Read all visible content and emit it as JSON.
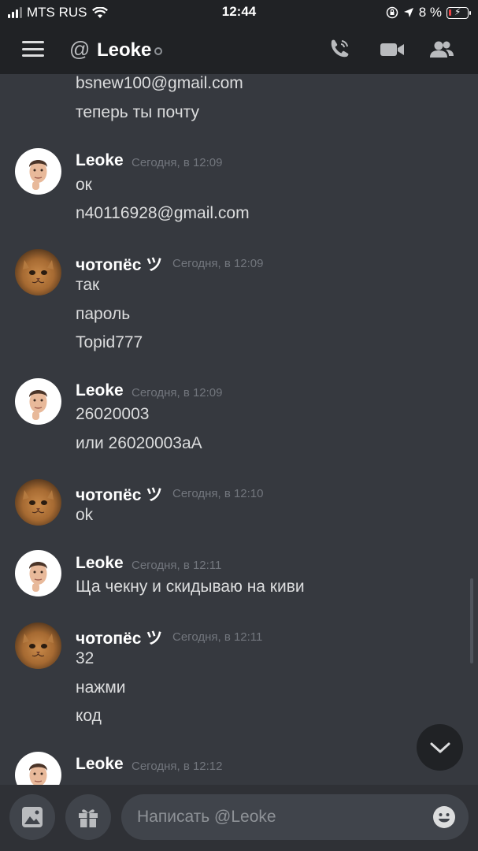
{
  "status_bar": {
    "carrier": "MTS RUS",
    "time": "12:44",
    "battery_percent": "8 %"
  },
  "header": {
    "title": "Leoke",
    "icons": [
      "menu-icon",
      "at-icon",
      "call-icon",
      "video-icon",
      "members-icon"
    ]
  },
  "messages": {
    "g0": {
      "lines": [
        "bsnew100@gmail.com",
        "теперь ты почту"
      ]
    },
    "g1": {
      "author": "Leoke",
      "time": "Сегодня, в 12:09",
      "lines": [
        "ок",
        "n40116928@gmail.com"
      ]
    },
    "g2": {
      "author": "чотопёс ツ",
      "time": "Сегодня, в 12:09",
      "lines": [
        "так",
        "пароль",
        "Topid777"
      ]
    },
    "g3": {
      "author": "Leoke",
      "time": "Сегодня, в 12:09",
      "lines": [
        "26020003",
        "или 26020003aA"
      ]
    },
    "g4": {
      "author": "чотопёс ツ",
      "time": "Сегодня, в 12:10",
      "lines": [
        "ok"
      ]
    },
    "g5": {
      "author": "Leoke",
      "time": "Сегодня, в 12:11",
      "lines": [
        "Ща чекну и скидываю на киви"
      ]
    },
    "g6": {
      "author": "чотопёс ツ",
      "time": "Сегодня, в 12:11",
      "lines": [
        "32",
        "нажми",
        "код"
      ]
    },
    "g7": {
      "author": "Leoke",
      "time": "Сегодня, в 12:12"
    }
  },
  "composer": {
    "placeholder": "Написать @Leoke"
  },
  "colors": {
    "background": "#36393f",
    "header": "#202225",
    "input": "#40444b",
    "text": "#dcddde",
    "muted": "#72767d"
  }
}
